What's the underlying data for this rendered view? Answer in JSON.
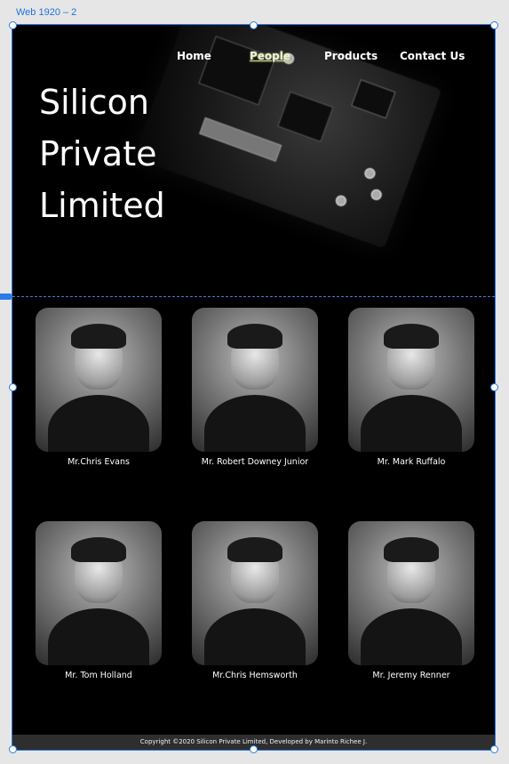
{
  "editor": {
    "artboard_label": "Web 1920 – 2"
  },
  "nav": {
    "items": [
      {
        "label": "Home",
        "active": false
      },
      {
        "label": "People",
        "active": true
      },
      {
        "label": "Products",
        "active": false
      },
      {
        "label": "Contact Us",
        "active": false
      }
    ]
  },
  "hero": {
    "title_lines": [
      "Silicon",
      "Private",
      "Limited"
    ]
  },
  "team": [
    {
      "name": "Mr.Chris Evans"
    },
    {
      "name": "Mr. Robert Downey Junior"
    },
    {
      "name": "Mr. Mark Ruffalo"
    },
    {
      "name": "Mr. Tom Holland"
    },
    {
      "name": "Mr.Chris Hemsworth"
    },
    {
      "name": "Mr. Jeremy Renner"
    }
  ],
  "footer": {
    "copyright": "Copyright ©2020 Silicon Private Limited, Developed by Marinto Richee J."
  },
  "colors": {
    "artboard_bg": "#000000",
    "selection": "#2a7be4",
    "footer_bg": "#2e2e2e",
    "active_nav_glow": "#c8d68a"
  }
}
